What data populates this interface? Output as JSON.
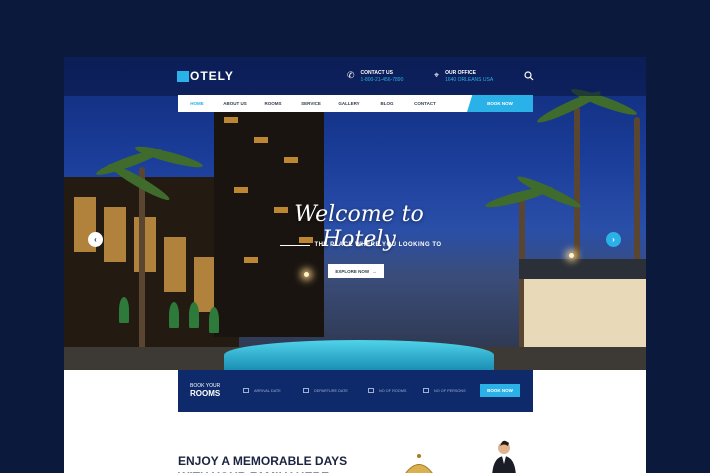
{
  "brand": {
    "logo_text": "OTELY",
    "logo_mark": "H"
  },
  "topbar": {
    "contact": {
      "label": "CONTACT US",
      "value": "1-800-21-456-7890"
    },
    "office": {
      "label": "OUR OFFICE",
      "value": "1640 ORLEANS USA"
    }
  },
  "nav": {
    "items": [
      {
        "label": "HOME",
        "active": true
      },
      {
        "label": "ABOUT US",
        "active": false
      },
      {
        "label": "ROOMS",
        "active": false
      },
      {
        "label": "SERVICE",
        "active": false
      },
      {
        "label": "GALLERY",
        "active": false
      },
      {
        "label": "BLOG",
        "active": false
      },
      {
        "label": "CONTACT",
        "active": false
      }
    ],
    "book_now": "BOOK NOW"
  },
  "hero": {
    "title": "Welcome to Hotely",
    "tagline": "THE PLACE WHERE YOU LOOKING TO",
    "explore_label": "EXPLORE NOW",
    "prev_arrow": "‹",
    "next_arrow": "›"
  },
  "booking": {
    "label_top": "BOOK YOUR",
    "label_bottom": "ROOMS",
    "fields": [
      "ARRIVAL DATE",
      "DEPARTURE DATE",
      "NO OF ROOMS",
      "NO OF PERSONS"
    ],
    "button": "BOOK NOW"
  },
  "section": {
    "heading": "ENJOY A MEMORABLE DAYS WITH YOUR FAMILY HERE"
  },
  "colors": {
    "accent": "#2ab1e8",
    "navy": "#0f2a6b",
    "background": "#0b1a3c"
  },
  "icons": {
    "phone": "phone-icon",
    "location": "location-pin-icon",
    "search": "search-icon",
    "calendar": "calendar-icon"
  }
}
